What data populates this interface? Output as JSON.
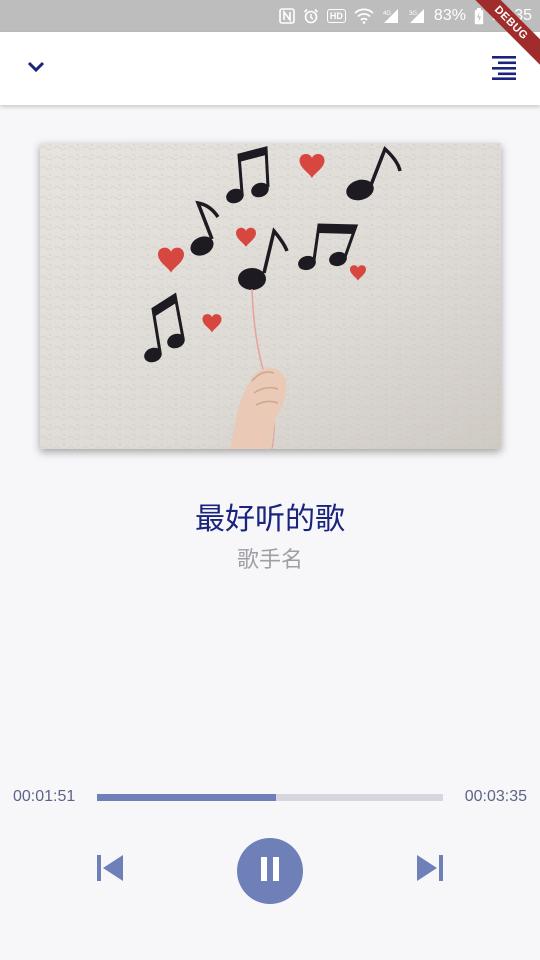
{
  "status_bar": {
    "battery": "83%",
    "time": "23:35",
    "icons": [
      "nfc-icon",
      "alarm-icon",
      "hd-icon",
      "wifi-icon",
      "signal-4g-icon",
      "signal-3g-icon",
      "battery-charging-icon"
    ],
    "hd_label": "HD"
  },
  "debug_banner": "DEBUG",
  "appbar": {
    "left_icon": "chevron-down-icon",
    "right_icon": "playlist-icon"
  },
  "song": {
    "title": "最好听的歌",
    "artist": "歌手名"
  },
  "progress": {
    "elapsed": "00:01:51",
    "total": "00:03:35",
    "fraction": 0.516
  },
  "controls": {
    "prev_icon": "skip-previous-icon",
    "play_icon": "pause-icon",
    "next_icon": "skip-next-icon"
  },
  "colors": {
    "accent": "#6f80b9",
    "title": "#1a237e",
    "artist": "#9e9ea6",
    "track": "#d6d7de"
  }
}
